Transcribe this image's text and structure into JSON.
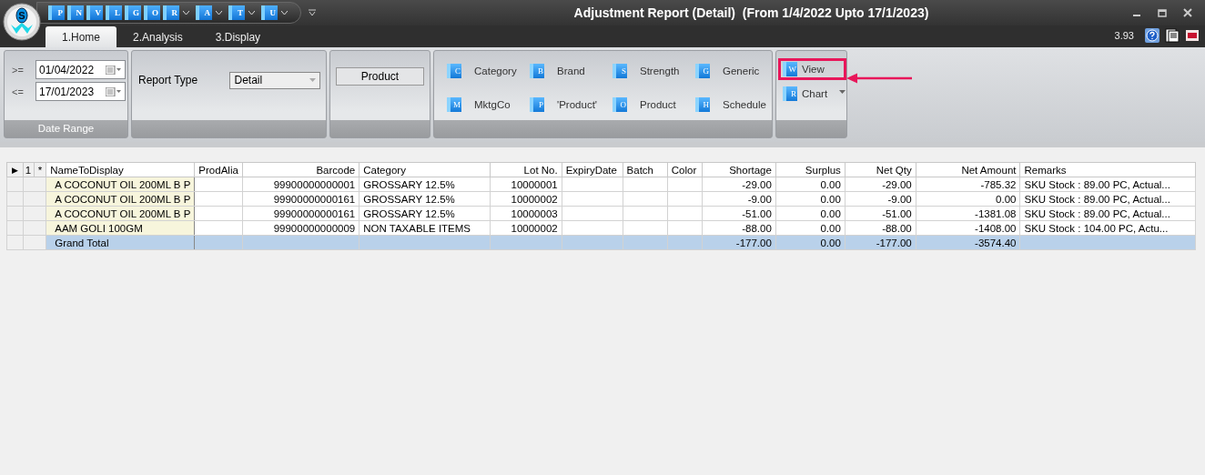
{
  "window": {
    "title": "Adjustment Report (Detail)  (From 1/4/2022 Upto 17/1/2023)",
    "logo_letter": "S"
  },
  "quick_access": [
    {
      "letter": "P",
      "dropdown": false
    },
    {
      "letter": "N",
      "dropdown": false
    },
    {
      "letter": "V",
      "dropdown": false
    },
    {
      "letter": "L",
      "dropdown": false
    },
    {
      "letter": "G",
      "dropdown": false
    },
    {
      "letter": "O",
      "dropdown": false
    },
    {
      "letter": "R",
      "dropdown": true
    },
    {
      "letter": "A",
      "dropdown": true
    },
    {
      "letter": "T",
      "dropdown": true
    },
    {
      "letter": "U",
      "dropdown": true
    }
  ],
  "tabs": [
    {
      "label": "1.Home",
      "selected": true
    },
    {
      "label": "2.Analysis",
      "selected": false
    },
    {
      "label": "3.Display",
      "selected": false
    }
  ],
  "version": "3.93",
  "ribbon": {
    "date_range": {
      "from_label": ">=",
      "from": "01/04/2022",
      "to_label": "<=",
      "to": "17/01/2023",
      "caption": "Date Range"
    },
    "report_type": {
      "label": "Report Type",
      "value": "Detail"
    },
    "product_button": "Product",
    "filters": [
      {
        "label": "Category",
        "icon_letter": "C"
      },
      {
        "label": "Brand",
        "icon_letter": "B"
      },
      {
        "label": "Strength",
        "icon_letter": "S"
      },
      {
        "label": "Generic",
        "icon_letter": "G"
      },
      {
        "label": "MktgCo",
        "icon_letter": "M"
      },
      {
        "label": "'Product'",
        "icon_letter": "P"
      },
      {
        "label": "Product",
        "icon_letter": "O"
      },
      {
        "label": "Schedule",
        "icon_letter": "H"
      }
    ],
    "actions": [
      {
        "label": "View",
        "icon_letter": "W",
        "highlighted": true,
        "dropdown": false
      },
      {
        "label": "Chart",
        "icon_letter": "R",
        "highlighted": false,
        "dropdown": true
      }
    ]
  },
  "table": {
    "header_indicator": "▶",
    "header_marks": [
      "1",
      "*"
    ],
    "columns": [
      "NameToDisplay",
      "ProdAlia",
      "Barcode",
      "Category",
      "Lot No.",
      "ExpiryDate",
      "Batch",
      "Color",
      "Shortage",
      "Surplus",
      "Net Qty",
      "Net Amount",
      "Remarks"
    ],
    "rows": [
      {
        "cells": [
          "A COCONUT OIL 200ML B P",
          null,
          "99900000000001",
          "GROSSARY 12.5%",
          "10000001",
          null,
          null,
          null,
          "-29.00",
          "0.00",
          "-29.00",
          "-785.32",
          "SKU Stock : 89.00 PC, Actual..."
        ]
      },
      {
        "cells": [
          "A COCONUT OIL 200ML B P",
          null,
          "99900000000161",
          "GROSSARY 12.5%",
          "10000002",
          null,
          null,
          null,
          "-9.00",
          "0.00",
          "-9.00",
          "0.00",
          "SKU Stock : 89.00 PC, Actual..."
        ]
      },
      {
        "cells": [
          "A COCONUT OIL 200ML B P",
          null,
          "99900000000161",
          "GROSSARY 12.5%",
          "10000003",
          null,
          null,
          null,
          "-51.00",
          "0.00",
          "-51.00",
          "-1381.08",
          "SKU Stock : 89.00 PC, Actual..."
        ]
      },
      {
        "cells": [
          "AAM GOLI 100GM",
          null,
          "99900000000009",
          "NON TAXABLE ITEMS",
          "10000002",
          null,
          null,
          null,
          "-88.00",
          "0.00",
          "-88.00",
          "-1408.00",
          "SKU Stock : 104.00 PC, Actu..."
        ]
      }
    ],
    "total": {
      "cells": [
        "Grand Total",
        null,
        null,
        null,
        null,
        null,
        null,
        null,
        "-177.00",
        "0.00",
        "-177.00",
        "-3574.40",
        null
      ]
    }
  }
}
